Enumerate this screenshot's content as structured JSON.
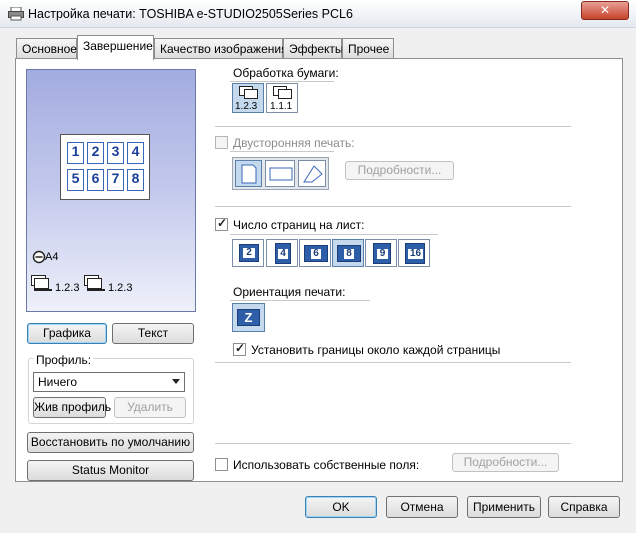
{
  "window": {
    "title": "Настройка печати: TOSHIBA e-STUDIO2505Series PCL6",
    "close_glyph": "✕"
  },
  "tabs": [
    "Основное",
    "Завершение",
    "Качество изображения",
    "Эффекты",
    "Прочее"
  ],
  "active_tab": "Завершение",
  "preview": {
    "paper_label": "A4",
    "collate_label_1": "1.2.3",
    "collate_label_2": "1.2.3",
    "page_numbers": [
      "1",
      "2",
      "3",
      "4",
      "5",
      "6",
      "7",
      "8"
    ]
  },
  "left": {
    "graphics_button": "Графика",
    "text_button": "Текст",
    "profile_label": "Профиль:",
    "profile_value": "Ничего",
    "save_profile_button": "Жив профиль",
    "delete_button": "Удалить",
    "restore_defaults_button": "Восстановить по умолчанию",
    "status_monitor_button": "Status Monitor"
  },
  "paper_handling": {
    "label": "Обработка бумаги:",
    "option1": "1.2.3",
    "option2": "1.1.1"
  },
  "duplex": {
    "label": "Двусторонняя печать:",
    "details_button": "Подробности...",
    "checked": false,
    "enabled": false
  },
  "pages_per_sheet": {
    "label": "Число страниц на лист:",
    "checked": true,
    "options": [
      "2",
      "4",
      "6",
      "8",
      "9",
      "16"
    ],
    "selected": "8"
  },
  "orientation": {
    "label": "Ориентация печати:",
    "icon_glyph": "Z"
  },
  "borders": {
    "label": "Установить границы около каждой страницы",
    "checked": true
  },
  "custom_margins": {
    "label": "Использовать собственные поля:",
    "details_button": "Подробности...",
    "checked": false
  },
  "footer": {
    "ok": "OK",
    "cancel": "Отмена",
    "apply": "Применить",
    "help": "Справка"
  }
}
